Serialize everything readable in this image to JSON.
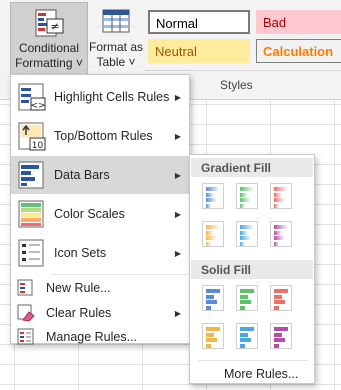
{
  "ribbon": {
    "conditional_formatting": {
      "line1": "Conditional",
      "line2": "Formatting ˅"
    },
    "format_as_table": {
      "line1": "Format as",
      "line2": "Table ˅"
    },
    "styles": {
      "normal": "Normal",
      "bad": "Bad",
      "neutral": "Neutral",
      "calculation": "Calculation"
    },
    "group_label": "Styles"
  },
  "menu": {
    "items": [
      {
        "label": "Highlight Cells Rules",
        "icon": "highlight-cells-icon",
        "submenu": true
      },
      {
        "label": "Top/Bottom Rules",
        "icon": "top-bottom-icon",
        "submenu": true
      },
      {
        "label": "Data Bars",
        "icon": "data-bars-icon",
        "submenu": true
      },
      {
        "label": "Color Scales",
        "icon": "color-scales-icon",
        "submenu": true
      },
      {
        "label": "Icon Sets",
        "icon": "icon-sets-icon",
        "submenu": true
      },
      {
        "label": "New Rule...",
        "icon": "new-rule-icon",
        "submenu": false
      },
      {
        "label": "Clear Rules",
        "icon": "clear-rules-icon",
        "submenu": true
      },
      {
        "label": "Manage Rules...",
        "icon": "manage-rules-icon",
        "submenu": false
      }
    ],
    "top10_badge": "10"
  },
  "submenu": {
    "gradient_fill": "Gradient Fill",
    "solid_fill": "Solid Fill",
    "more_rules": "More Rules...",
    "bar_colors": [
      "#5b8bd6",
      "#5fbf6a",
      "#e8726a",
      "#f0b64b",
      "#49a8e0",
      "#b04fa3"
    ]
  },
  "colors": {
    "highlight_bg": "#d8d8d8",
    "ribbon_bg": "#f3f3f3",
    "pressed_button": "#d0d0d0"
  }
}
